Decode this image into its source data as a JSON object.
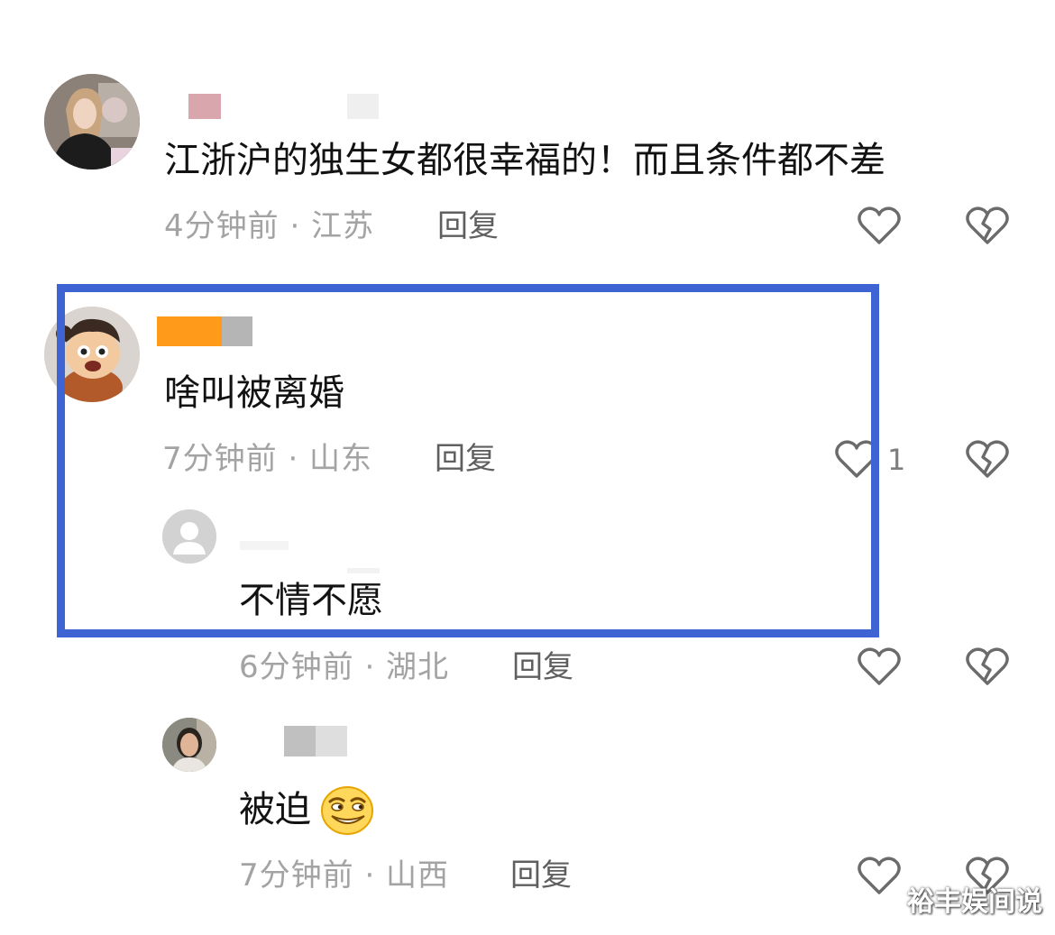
{
  "comments": [
    {
      "text": "江浙沪的独生女都很幸福的！而且条件都不差",
      "meta": "4分钟前 · 江苏",
      "reply_label": "回复",
      "like_count": ""
    },
    {
      "text": "啥叫被离婚",
      "meta": "7分钟前 · 山东",
      "reply_label": "回复",
      "like_count": "1"
    },
    {
      "text": "不情不愿",
      "meta": "6分钟前 · 湖北",
      "reply_label": "回复",
      "like_count": ""
    },
    {
      "text": "被迫",
      "meta": "7分钟前 · 山西",
      "reply_label": "回复",
      "like_count": ""
    }
  ],
  "watermark": "裕丰娱间说",
  "colors": {
    "highlight_border": "#3e63d2",
    "name_redact_pink": "#d9a6ad",
    "name_redact_orange": "#ff9a1a",
    "meta_text": "#a3a3a3"
  },
  "icons": {
    "like": "heart-outline-icon",
    "dislike": "broken-heart-icon",
    "default_avatar": "default-avatar-icon",
    "emoji": "smirk-emoji-icon"
  }
}
